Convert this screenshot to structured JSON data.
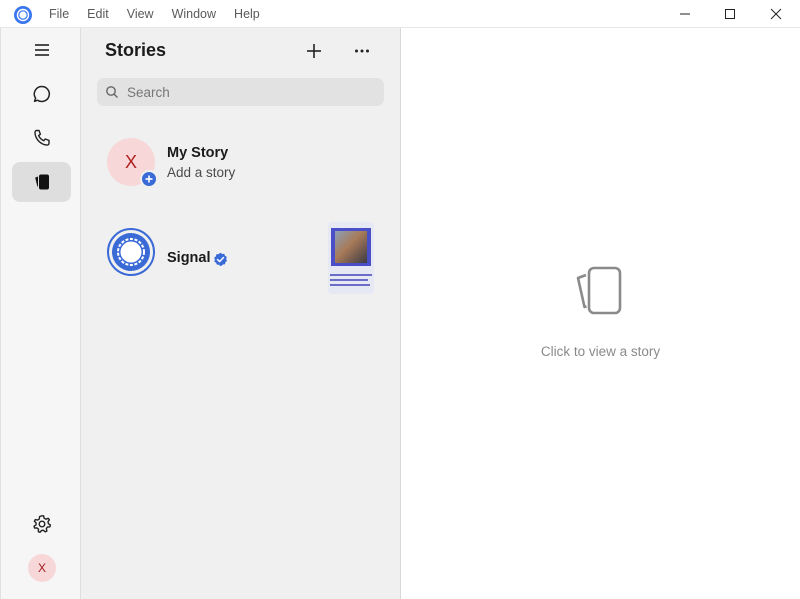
{
  "menu": {
    "items": [
      "File",
      "Edit",
      "View",
      "Window",
      "Help"
    ]
  },
  "window_controls": {
    "minimize": "minimize-icon",
    "maximize": "maximize-icon",
    "close": "close-icon"
  },
  "rail": {
    "items": [
      {
        "id": "menu",
        "icon": "hamburger-icon"
      },
      {
        "id": "chats",
        "icon": "chat-bubble-icon"
      },
      {
        "id": "calls",
        "icon": "phone-icon"
      },
      {
        "id": "stories",
        "icon": "stories-icon",
        "active": true
      }
    ],
    "settings_icon": "gear-icon",
    "avatar_initial": "X"
  },
  "stories": {
    "title": "Stories",
    "search_placeholder": "Search",
    "my_story": {
      "avatar_initial": "X",
      "name": "My Story",
      "subtitle": "Add a story"
    },
    "items": [
      {
        "name": "Signal",
        "verified": true,
        "has_thumbnail": true
      }
    ]
  },
  "viewer": {
    "empty_text": "Click to view a story"
  },
  "colors": {
    "accent": "#3a6ad6",
    "avatar_bg": "#f7d7d7",
    "panel_bg": "#f0f0f0"
  }
}
